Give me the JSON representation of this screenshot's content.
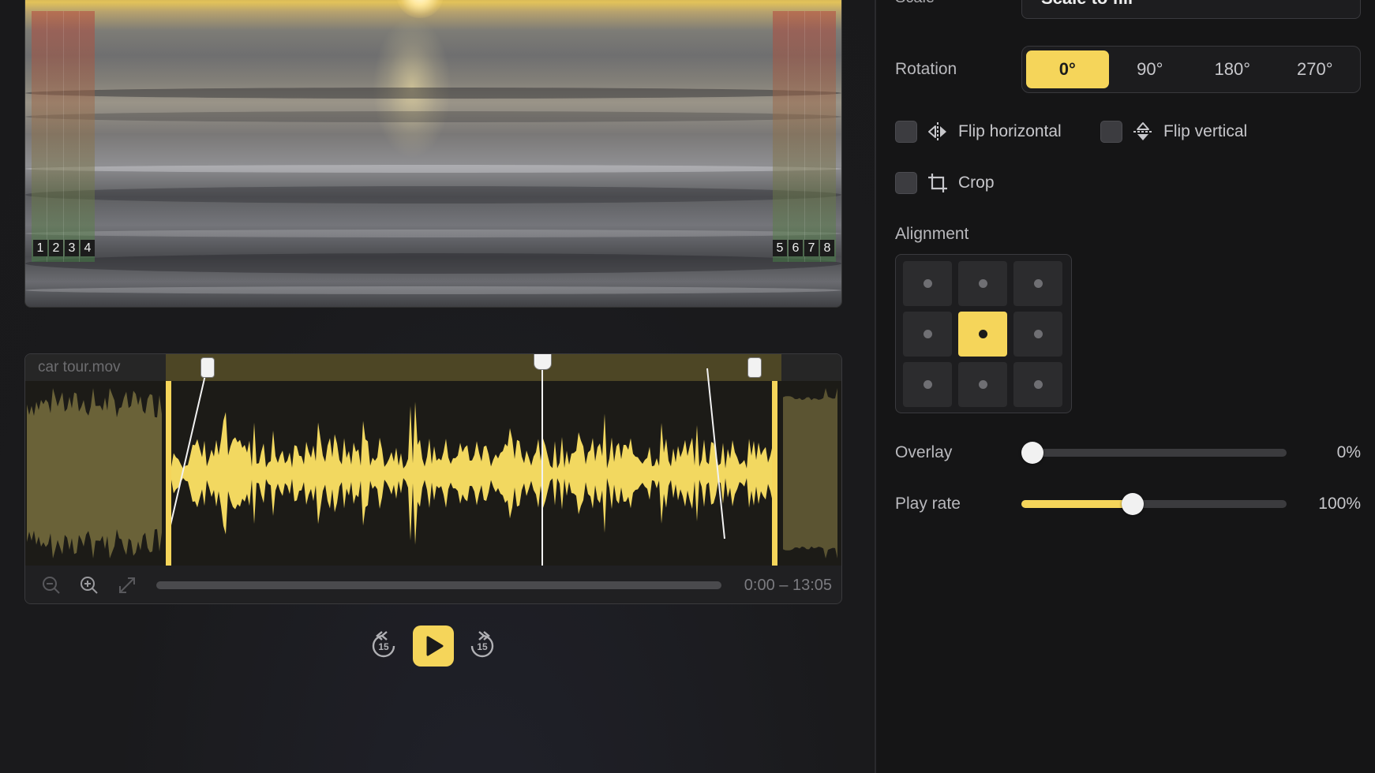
{
  "preview": {
    "left_zone_numbers": [
      "1",
      "2",
      "3",
      "4"
    ],
    "right_zone_numbers": [
      "5",
      "6",
      "7",
      "8"
    ]
  },
  "timeline": {
    "clip_name": "car tour.mov",
    "time_range": "0:00 – 13:05",
    "icons": [
      "zoom-out-icon",
      "zoom-in-icon",
      "expand-icon"
    ]
  },
  "transport": {
    "skip_back_label": "15",
    "skip_forward_label": "15"
  },
  "inspector": {
    "scale_label": "Scale",
    "scale_value": "Scale to fill",
    "rotation_label": "Rotation",
    "rotation_options": [
      "0°",
      "90°",
      "180°",
      "270°"
    ],
    "rotation_selected": "0°",
    "flip_horizontal_label": "Flip horizontal",
    "flip_vertical_label": "Flip vertical",
    "crop_label": "Crop",
    "alignment_label": "Alignment",
    "alignment_selected": "center",
    "overlay_label": "Overlay",
    "overlay_value": "0%",
    "overlay_level": 0,
    "play_rate_label": "Play rate",
    "play_rate_value": "100%",
    "play_rate_level": 0.42
  },
  "colors": {
    "accent": "#f5d55a",
    "background": "#1b1b1d",
    "panel": "#151516"
  }
}
